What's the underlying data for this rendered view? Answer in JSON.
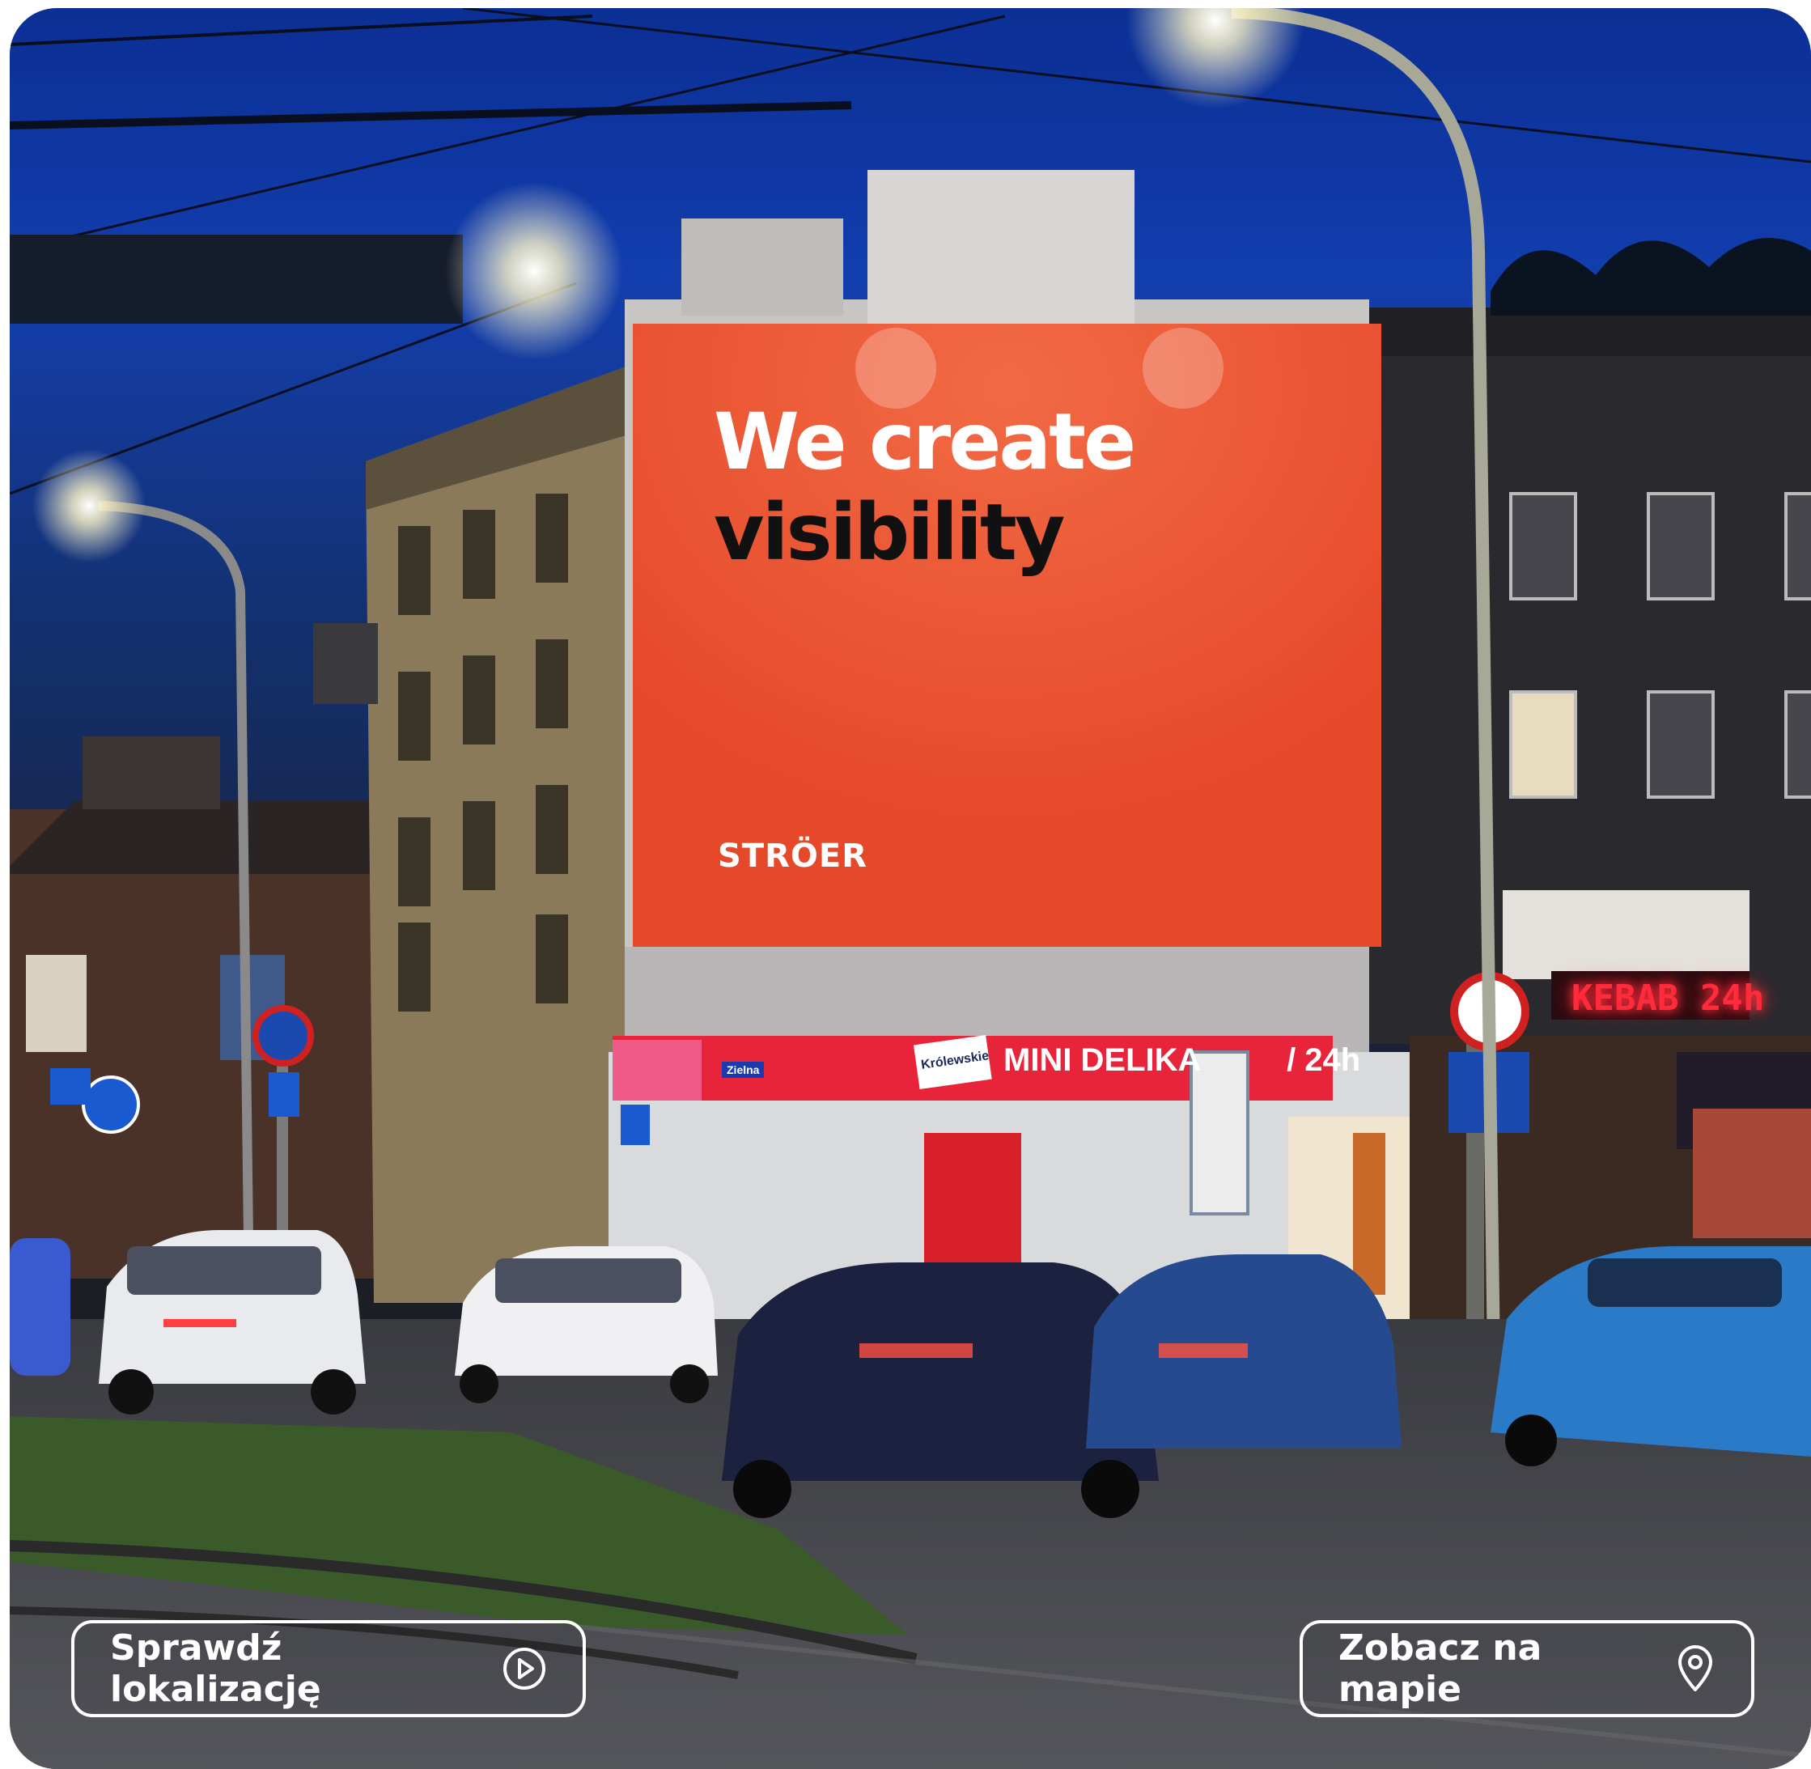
{
  "photo": {
    "description_icon": "night-street-billboard-photo",
    "accent": "#e8502f"
  },
  "billboard": {
    "headline_line1": "We create",
    "headline_line2": "visibility",
    "logo": "STRÖER"
  },
  "storefronts": {
    "shop_sign": "MINI DELIKA",
    "shop_sign_suffix": "/ 24h",
    "neon": "KEBAB 24h",
    "street_sign": "Zielna",
    "brand_sign": "Królewskie"
  },
  "actions": {
    "check_location_label": "Sprawdź lokalizację",
    "check_location_icon": "play-circle-icon",
    "see_on_map_label": "Zobacz na mapie",
    "see_on_map_icon": "map-pin-icon"
  }
}
